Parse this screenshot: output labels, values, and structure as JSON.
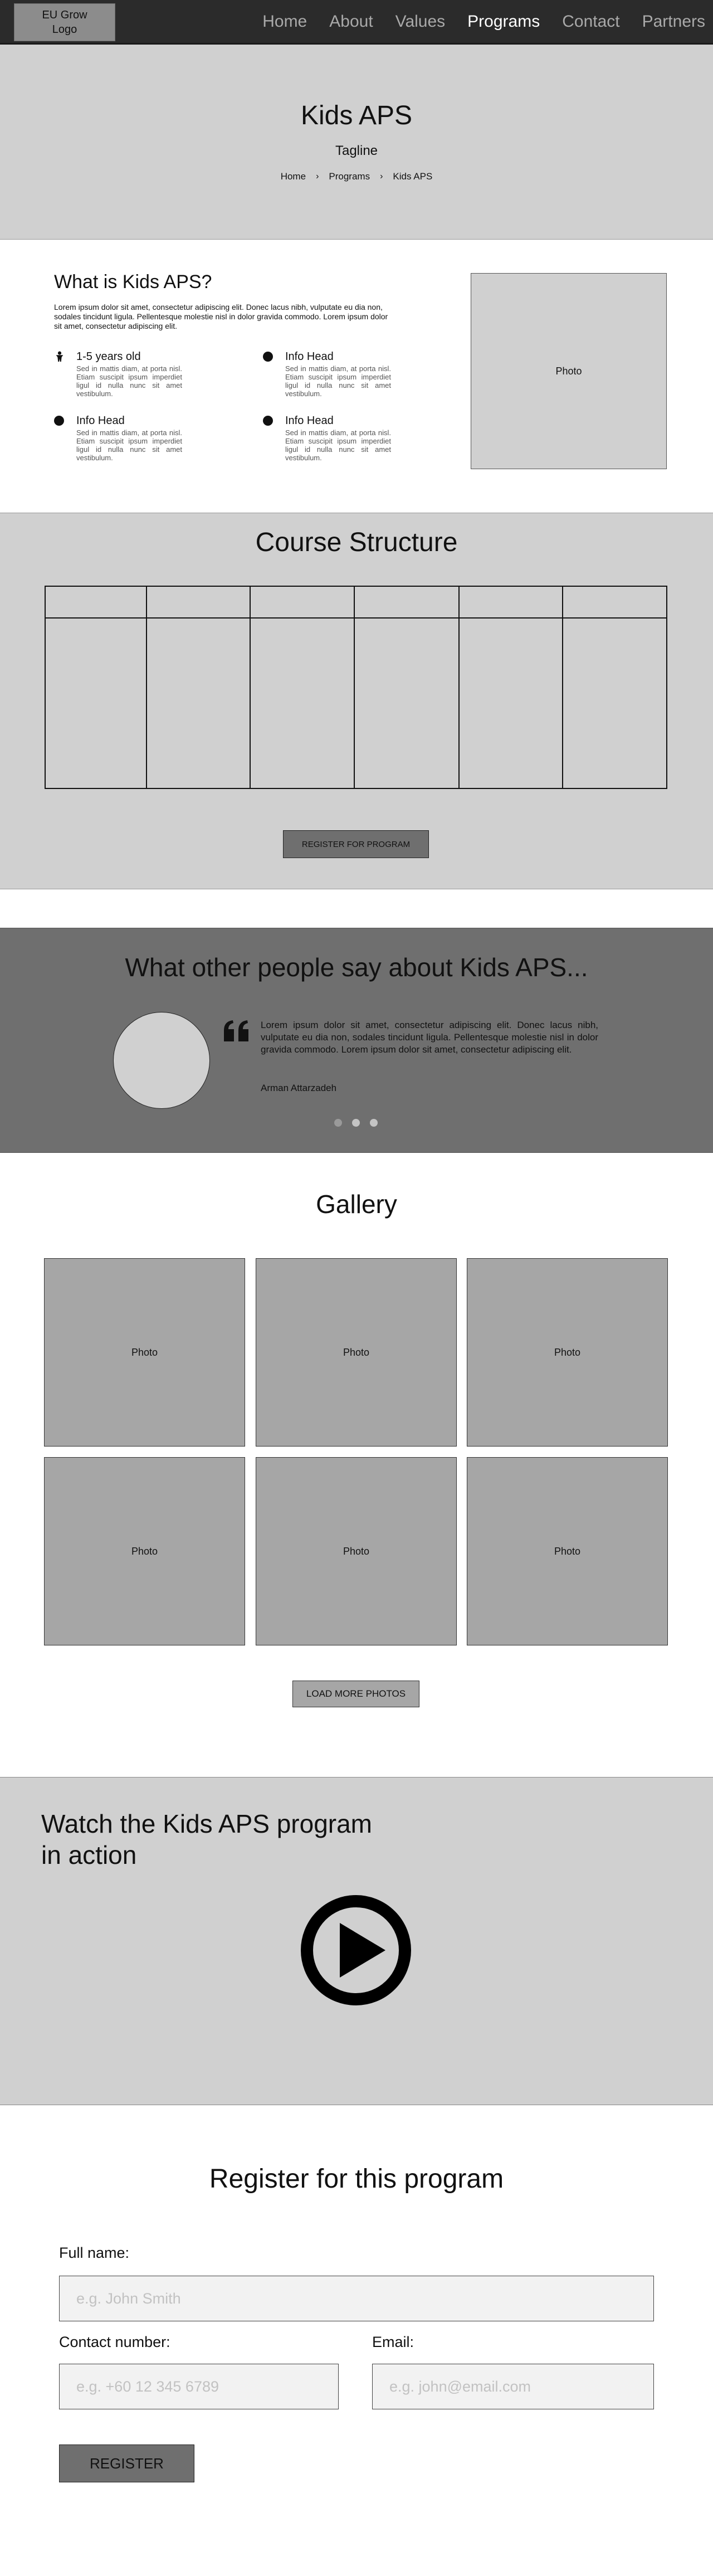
{
  "nav": {
    "logo": "EU Grow\nLogo",
    "links": [
      {
        "label": "Home"
      },
      {
        "label": "About"
      },
      {
        "label": "Values"
      },
      {
        "label": "Programs",
        "active": true
      },
      {
        "label": "Contact"
      },
      {
        "label": "Partners"
      }
    ]
  },
  "hero": {
    "title": "Kids APS",
    "tagline": "Tagline",
    "breadcrumb": [
      "Home",
      "Programs",
      "Kids APS"
    ],
    "separator": "›"
  },
  "whatis": {
    "title": "What is Kids APS?",
    "intro": "Lorem ipsum dolor sit amet, consectetur adipiscing elit. Donec lacus nibh, vulputate eu dia non, sodales tincidunt ligula. Pellentesque molestie nisl in dolor gravida commodo. Lorem ipsum dolor sit amet, consectetur adipiscing elit.",
    "items": [
      {
        "icon": "child-icon",
        "title": "1-5 years old",
        "text": "Sed in mattis diam, at porta nisl. Etiam suscipit ipsum imperdiet ligul id nulla nunc sit amet vestibulum."
      },
      {
        "icon": "bullet-icon",
        "title": "Info Head",
        "text": "Sed in mattis diam, at porta nisl. Etiam suscipit ipsum imperdiet ligul id nulla nunc sit amet vestibulum."
      },
      {
        "icon": "bullet-icon",
        "title": "Info Head",
        "text": "Sed in mattis diam, at porta nisl. Etiam suscipit ipsum imperdiet ligul id nulla nunc sit amet vestibulum."
      },
      {
        "icon": "bullet-icon",
        "title": "Info Head",
        "text": "Sed in mattis diam, at porta nisl. Etiam suscipit ipsum imperdiet ligul id nulla nunc sit amet vestibulum."
      }
    ],
    "photo_label": "Photo"
  },
  "course": {
    "title": "Course Structure",
    "button": "REGISTER FOR PROGRAM"
  },
  "testimonial": {
    "title": "What other people say about Kids APS...",
    "quote": "Lorem ipsum dolor sit amet, consectetur adipiscing elit. Donec lacus nibh, vulputate eu dia non, sodales tincidunt ligula. Pellentesque molestie nisl in dolor gravida commodo. Lorem ipsum dolor sit amet, consectetur adipiscing elit.",
    "author": "Arman Attarzadeh"
  },
  "gallery": {
    "title": "Gallery",
    "photos": [
      "Photo",
      "Photo",
      "Photo",
      "Photo",
      "Photo",
      "Photo"
    ],
    "button": "LOAD MORE PHOTOS"
  },
  "video": {
    "title": "Watch the Kids APS program in action"
  },
  "register": {
    "title": "Register for this program",
    "name_label": "Full name:",
    "name_placeholder": "e.g. John Smith",
    "phone_label": "Contact number:",
    "phone_placeholder": "e.g. +60 12 345 6789",
    "email_label": "Email:",
    "email_placeholder": "e.g. john@email.com",
    "button": "REGISTER"
  }
}
